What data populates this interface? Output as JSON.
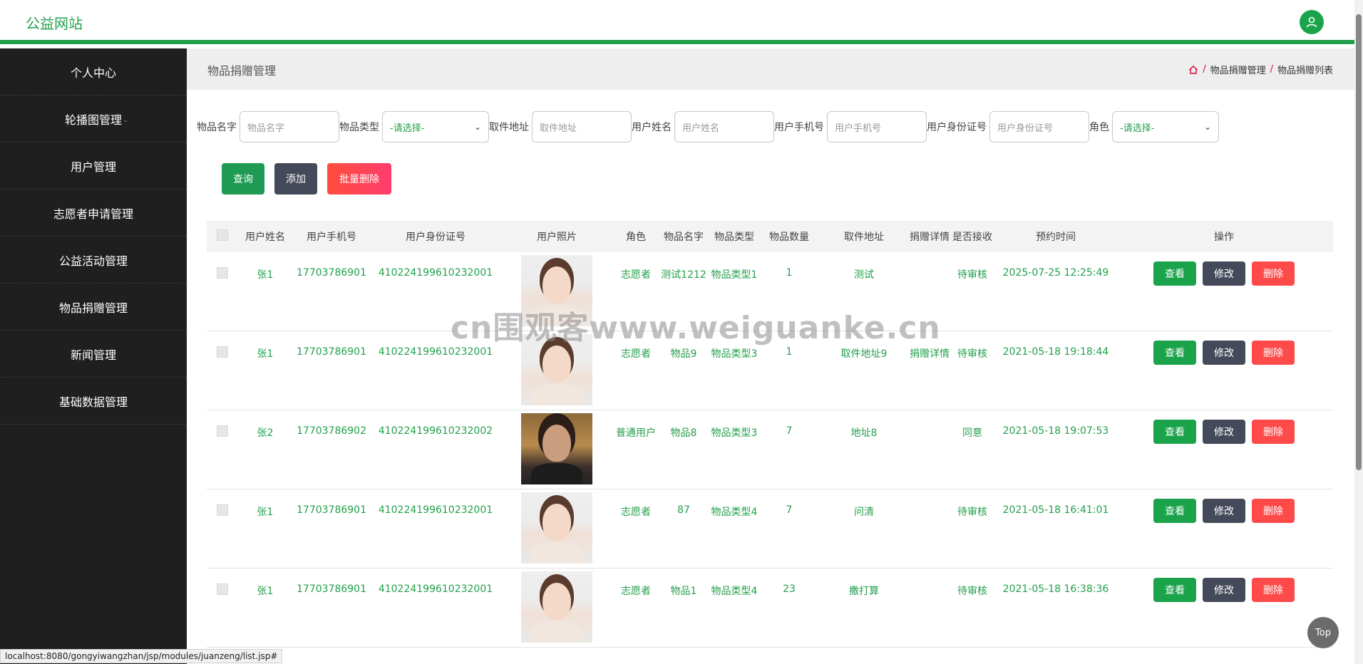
{
  "header": {
    "brand": "公益网站"
  },
  "sidebar": {
    "items": [
      {
        "label": "个人中心",
        "caret": false
      },
      {
        "label": "轮播图管理",
        "caret": true
      },
      {
        "label": "用户管理",
        "caret": false
      },
      {
        "label": "志愿者申请管理",
        "caret": true
      },
      {
        "label": "公益活动管理",
        "caret": false
      },
      {
        "label": "物品捐赠管理",
        "caret": false
      },
      {
        "label": "新闻管理",
        "caret": false
      },
      {
        "label": "基础数据管理",
        "caret": true
      }
    ]
  },
  "page": {
    "title": "物品捐赠管理",
    "breadcrumb": [
      "物品捐赠管理",
      "物品捐赠列表"
    ]
  },
  "filters": {
    "item_name": {
      "label": "物品名字",
      "placeholder": "物品名字"
    },
    "item_type": {
      "label": "物品类型",
      "value": "-请选择-"
    },
    "pickup_addr": {
      "label": "取件地址",
      "placeholder": "取件地址"
    },
    "user_name": {
      "label": "用户姓名",
      "placeholder": "用户姓名"
    },
    "user_phone": {
      "label": "用户手机号",
      "placeholder": "用户手机号"
    },
    "user_id": {
      "label": "用户身份证号",
      "placeholder": "用户身份证号"
    },
    "role": {
      "label": "角色",
      "value": "-请选择-"
    }
  },
  "actions": {
    "query": "查询",
    "add": "添加",
    "batch_delete": "批量删除"
  },
  "table": {
    "headers": [
      "用户姓名",
      "用户手机号",
      "用户身份证号",
      "用户照片",
      "角色",
      "物品名字",
      "物品类型",
      "物品数量",
      "取件地址",
      "捐赠详情",
      "是否接收",
      "预约时间",
      "操作"
    ],
    "rows": [
      {
        "name": "张1",
        "phone": "17703786901",
        "idcard": "410224199610232001",
        "photo": "woman",
        "role": "志愿者",
        "item": "测试1212",
        "type": "物品类型1",
        "qty": "1",
        "addr": "测试",
        "detail": "",
        "accept": "待审核",
        "time": "2025-07-25 12:25:49"
      },
      {
        "name": "张1",
        "phone": "17703786901",
        "idcard": "410224199610232001",
        "photo": "woman",
        "role": "志愿者",
        "item": "物品9",
        "type": "物品类型3",
        "qty": "1",
        "addr": "取件地址9",
        "detail": "捐赠详情",
        "accept": "待审核",
        "time": "2021-05-18 19:18:44"
      },
      {
        "name": "张2",
        "phone": "17703786902",
        "idcard": "410224199610232002",
        "photo": "man",
        "role": "普通用户",
        "item": "物品8",
        "type": "物品类型3",
        "qty": "7",
        "addr": "地址8",
        "detail": "",
        "accept": "同意",
        "time": "2021-05-18 19:07:53"
      },
      {
        "name": "张1",
        "phone": "17703786901",
        "idcard": "410224199610232001",
        "photo": "woman",
        "role": "志愿者",
        "item": "87",
        "type": "物品类型4",
        "qty": "7",
        "addr": "问清",
        "detail": "",
        "accept": "待审核",
        "time": "2021-05-18 16:41:01"
      },
      {
        "name": "张1",
        "phone": "17703786901",
        "idcard": "410224199610232001",
        "photo": "woman",
        "role": "志愿者",
        "item": "物品1",
        "type": "物品类型4",
        "qty": "23",
        "addr": "撒打算",
        "detail": "",
        "accept": "待审核",
        "time": "2021-05-18 16:38:36"
      }
    ],
    "ops": {
      "view": "查看",
      "edit": "修改",
      "delete": "删除"
    }
  },
  "watermark": "cn围观客www.weiguanke.cn",
  "top_button": "Top",
  "status_url": "localhost:8080/gongyiwangzhan/jsp/modules/juanzeng/list.jsp#"
}
